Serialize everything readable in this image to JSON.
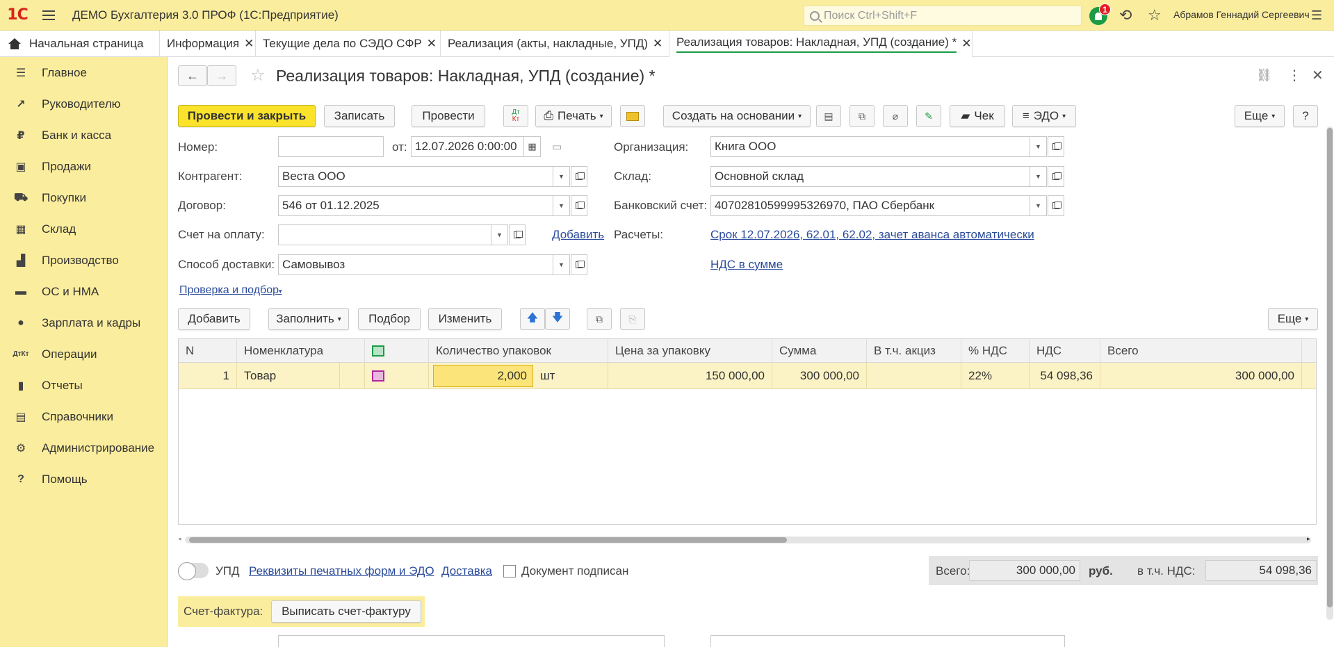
{
  "app": {
    "logo": "1С",
    "title": "ДЕМО Бухгалтерия 3.0 ПРОФ  (1С:Предприятие)",
    "search_placeholder": "Поиск Ctrl+Shift+F",
    "notifications_count": "1",
    "user": "Абрамов Геннадий Сергеевич"
  },
  "tabs": [
    {
      "label": "Начальная страница"
    },
    {
      "label": "Информация"
    },
    {
      "label": "Текущие дела по СЭДО СФР"
    },
    {
      "label": "Реализация (акты, накладные, УПД)"
    },
    {
      "label": "Реализация товаров: Накладная, УПД (создание) *"
    }
  ],
  "sidebar": {
    "items": [
      {
        "label": "Главное"
      },
      {
        "label": "Руководителю"
      },
      {
        "label": "Банк и касса"
      },
      {
        "label": "Продажи"
      },
      {
        "label": "Покупки"
      },
      {
        "label": "Склад"
      },
      {
        "label": "Производство"
      },
      {
        "label": "ОС и НМА"
      },
      {
        "label": "Зарплата и кадры"
      },
      {
        "label": "Операции"
      },
      {
        "label": "Отчеты"
      },
      {
        "label": "Справочники"
      },
      {
        "label": "Администрирование"
      },
      {
        "label": "Помощь"
      }
    ]
  },
  "form": {
    "title": "Реализация товаров: Накладная, УПД (создание) *",
    "toolbar": {
      "post_close": "Провести и закрыть",
      "save": "Записать",
      "post": "Провести",
      "dtkt": "Дт Кт",
      "print": "Печать",
      "create_based": "Создать на основании",
      "check": "Чек",
      "edo": "ЭДО",
      "more": "Еще",
      "help": "?"
    },
    "fields": {
      "number_label": "Номер:",
      "number_value": "",
      "date_label": "от:",
      "date_value": "12.07.2026  0:00:00",
      "org_label": "Организация:",
      "org_value": "Книга ООО",
      "contractor_label": "Контрагент:",
      "contractor_value": "Веста ООО",
      "warehouse_label": "Склад:",
      "warehouse_value": "Основной склад",
      "contract_label": "Договор:",
      "contract_value": "546 от 01.12.2025",
      "bank_label": "Банковский счет:",
      "bank_value": "40702810599995326970, ПАО Сбербанк",
      "invoice_label": "Счет на оплату:",
      "invoice_value": "",
      "add_link": "Добавить",
      "calc_label": "Расчеты:",
      "calc_link": "Срок 12.07.2026, 62.01, 62.02, зачет аванса автоматически",
      "delivery_label": "Способ доставки:",
      "delivery_value": "Самовывоз",
      "vat_link": "НДС в сумме",
      "check_link": "Проверка и подбор"
    },
    "table_toolbar": {
      "add": "Добавить",
      "fill": "Заполнить",
      "pick": "Подбор",
      "change": "Изменить",
      "more": "Еще"
    },
    "table": {
      "columns": [
        "N",
        "Номенклатура",
        "",
        "Количество упаковок",
        "Цена за упаковку",
        "Сумма",
        "В т.ч. акциз",
        "% НДС",
        "НДС",
        "Всего"
      ],
      "rows": [
        {
          "n": "1",
          "item": "Товар",
          "qty": "2,000",
          "unit": "шт",
          "price": "150 000,00",
          "sum": "300 000,00",
          "excise": "",
          "vat_rate": "22%",
          "vat": "54 098,36",
          "total": "300 000,00"
        }
      ]
    },
    "footer": {
      "upd": "УПД",
      "print_details_link": "Реквизиты печатных форм и ЭДО",
      "delivery_link": "Доставка",
      "signed": "Документ подписан",
      "total_label": "Всего:",
      "total_value": "300 000,00",
      "currency": "руб.",
      "vat_label": "в т.ч. НДС:",
      "vat_value": "54 098,36",
      "invoice_label": "Счет-фактура:",
      "invoice_button": "Выписать счет-фактуру"
    }
  },
  "colors": {
    "accent_yellow": "#fbed9e",
    "primary_button": "#fbe32b",
    "active_tab_underline": "#1b9b45",
    "link": "#2a4b9b",
    "logo_red": "#d8241c"
  }
}
